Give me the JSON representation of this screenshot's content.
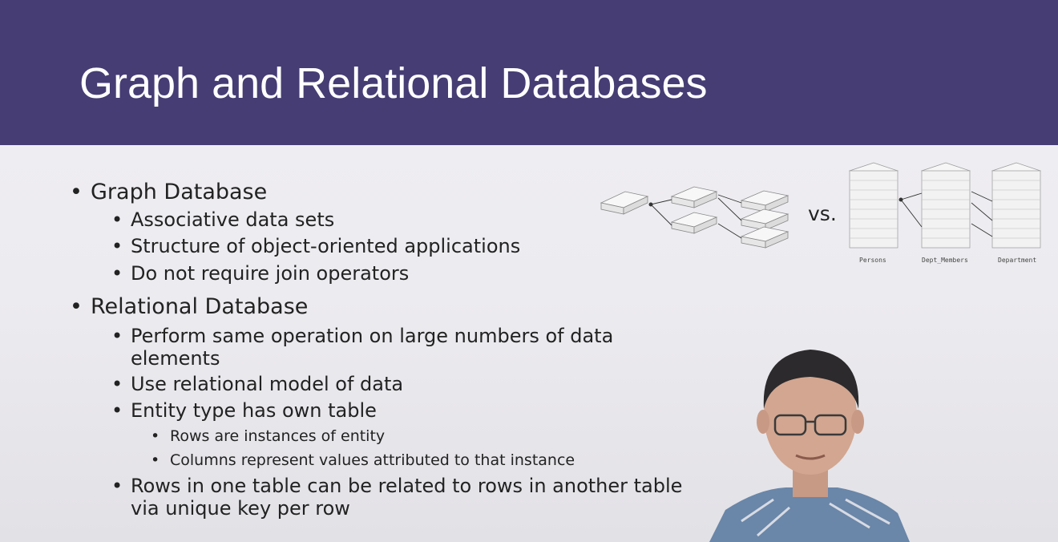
{
  "slide": {
    "title": "Graph and Relational Databases"
  },
  "bullets": {
    "graph": {
      "heading": "Graph Database",
      "items": [
        "Associative data sets",
        "Structure of object-oriented applications",
        "Do not require join operators"
      ]
    },
    "relational": {
      "heading": "Relational Database",
      "items": [
        "Perform same operation on large numbers of data elements",
        "Use relational model of data",
        "Entity type has own table",
        "Rows in one table can be related to rows in another table via unique key per row"
      ],
      "item1_line1": "Perform same operation on large numbers of data",
      "item1_line2": "elements",
      "item4_line1": "Rows in one table can be related to rows in another table",
      "item4_line2": "via unique key per row",
      "subitems": [
        "Rows are instances of entity",
        "Columns represent values attributed to that instance"
      ]
    }
  },
  "diagram": {
    "vs_label": "vs.",
    "table_labels": [
      "Persons",
      "Dept_Members",
      "Department"
    ]
  },
  "colors": {
    "header_bg": "#463d74",
    "title_text": "#ffffff",
    "body_text": "#222222"
  }
}
